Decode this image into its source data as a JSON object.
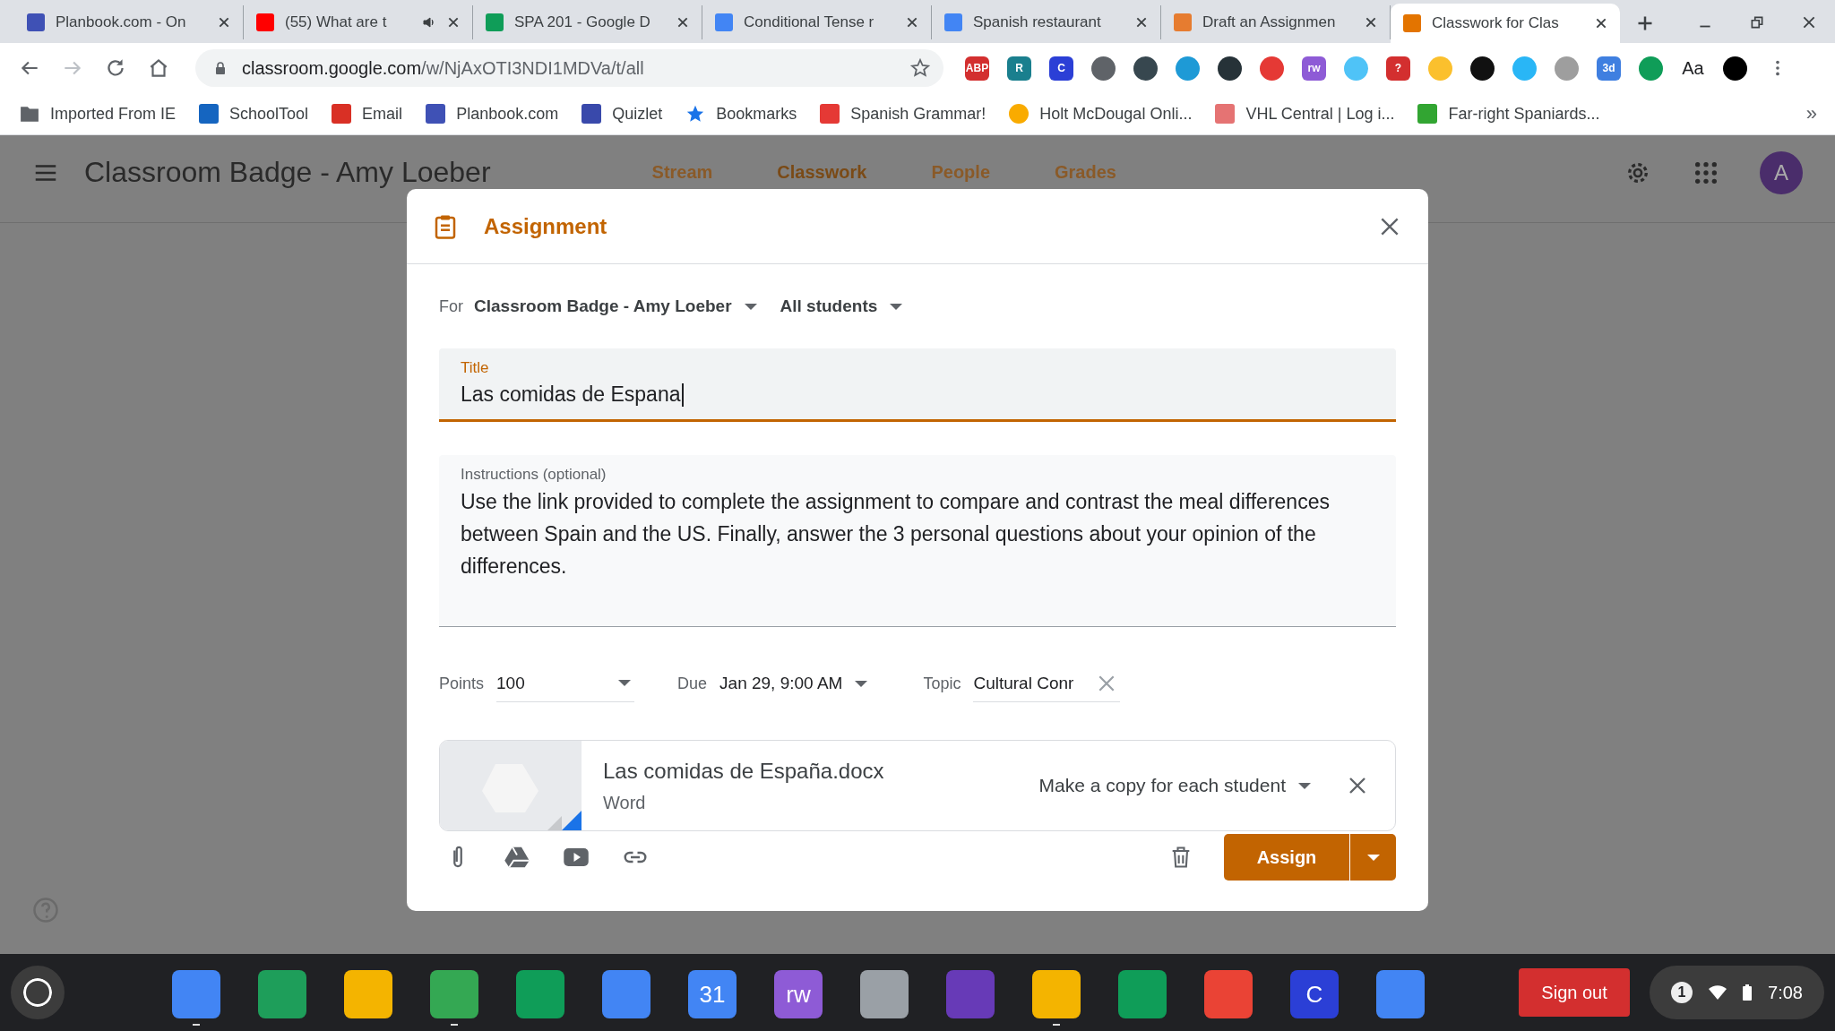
{
  "browser": {
    "tabs": [
      {
        "title": "Planbook.com - On",
        "color": "#3f51b5",
        "audio": false,
        "selected": false
      },
      {
        "title": "(55) What are t",
        "color": "#ff0000",
        "audio": true,
        "selected": false
      },
      {
        "title": "SPA 201 - Google D",
        "color": "#0f9d58",
        "audio": false,
        "selected": false
      },
      {
        "title": "Conditional Tense r",
        "color": "#4285f4",
        "audio": false,
        "selected": false
      },
      {
        "title": "Spanish restaurant",
        "color": "#4285f4",
        "audio": false,
        "selected": false
      },
      {
        "title": "Draft an Assignmen",
        "color": "#e67c30",
        "audio": false,
        "selected": false
      },
      {
        "title": "Classwork for Clas",
        "color": "#e37400",
        "audio": false,
        "selected": true
      }
    ],
    "address": {
      "host": "classroom.google.com",
      "path": "/w/NjAxOTI3NDI1MDVa/t/all"
    },
    "extensions": [
      {
        "kind": "badge",
        "label": "ABP",
        "color": "#d32f2f"
      },
      {
        "kind": "badge",
        "label": "R",
        "color": "#1a7f8e"
      },
      {
        "kind": "badge",
        "label": "C",
        "color": "#2b3fd6"
      },
      {
        "kind": "round",
        "color": "#5f6368"
      },
      {
        "kind": "round",
        "color": "#37474f"
      },
      {
        "kind": "round",
        "color": "#1e9ad6"
      },
      {
        "kind": "round",
        "color": "#263238"
      },
      {
        "kind": "round",
        "color": "#e53935"
      },
      {
        "kind": "badge",
        "label": "rw",
        "color": "#8e5bd6"
      },
      {
        "kind": "round",
        "color": "#4fc3f7"
      },
      {
        "kind": "badge",
        "label": "?",
        "color": "#d32f2f"
      },
      {
        "kind": "round",
        "color": "#fbc02d"
      },
      {
        "kind": "round",
        "color": "#111111"
      },
      {
        "kind": "round",
        "color": "#29b6f6"
      },
      {
        "kind": "round",
        "color": "#9e9e9e"
      },
      {
        "kind": "badge",
        "label": "3d",
        "color": "#3f7fe0"
      },
      {
        "kind": "round",
        "color": "#0f9d58"
      },
      {
        "kind": "text",
        "label": "Aa",
        "color": "#202124"
      },
      {
        "kind": "round",
        "color": "#000000"
      }
    ],
    "bookmarks": [
      {
        "kind": "folder",
        "label": "Imported From IE",
        "color": "#5f6368"
      },
      {
        "kind": "site",
        "label": "SchoolTool",
        "color": "#1565c0"
      },
      {
        "kind": "site",
        "label": "Email",
        "color": "#d93025"
      },
      {
        "kind": "site",
        "label": "Planbook.com",
        "color": "#3f51b5"
      },
      {
        "kind": "site",
        "label": "Quizlet",
        "color": "#3949ab"
      },
      {
        "kind": "star",
        "label": "Bookmarks",
        "color": "#1a73e8"
      },
      {
        "kind": "site",
        "label": "Spanish Grammar!",
        "color": "#e53935"
      },
      {
        "kind": "dot",
        "label": "Holt McDougal Onli...",
        "color": "#f9ab00"
      },
      {
        "kind": "site",
        "label": "VHL Central | Log i...",
        "color": "#e57373"
      },
      {
        "kind": "site",
        "label": "Far-right Spaniards...",
        "color": "#32a532"
      }
    ],
    "more": "»"
  },
  "header": {
    "title": "Classroom Badge - Amy Loeber",
    "avatar": "A",
    "nav": [
      {
        "label": "Stream",
        "selected": false
      },
      {
        "label": "Classwork",
        "selected": true
      },
      {
        "label": "People",
        "selected": false
      },
      {
        "label": "Grades",
        "selected": false
      }
    ]
  },
  "dialog": {
    "title": "Assignment",
    "for_label": "For",
    "class": "Classroom Badge - Amy Loeber",
    "students": "All students",
    "title_field": {
      "label": "Title",
      "value": "Las comidas de Espana"
    },
    "instructions": {
      "label": "Instructions (optional)",
      "value": "Use the link provided to complete the assignment to compare and contrast the meal differences between Spain and the US. Finally, answer the 3 personal questions about your opinion of the differences."
    },
    "points": {
      "label": "Points",
      "value": "100"
    },
    "due": {
      "label": "Due",
      "value": "Jan 29, 9:00 AM"
    },
    "topic": {
      "label": "Topic",
      "value": "Cultural Conr"
    },
    "attachment": {
      "name": "Las comidas de España.docx",
      "type": "Word",
      "mode": "Make a copy for each student"
    },
    "assign": "Assign"
  },
  "shelf": {
    "apps": [
      {
        "color": "#4285f4",
        "running": true
      },
      {
        "color": "#1e9e5a",
        "running": false
      },
      {
        "color": "#f4b400",
        "running": false
      },
      {
        "color": "#34a853",
        "running": true
      },
      {
        "color": "#0f9d58",
        "running": false
      },
      {
        "color": "#4285f4",
        "running": false
      },
      {
        "color": "#4285f4",
        "label": "31",
        "running": false
      },
      {
        "color": "#8e5bd6",
        "label": "rw",
        "running": false
      },
      {
        "color": "#9aa0a6",
        "running": false
      },
      {
        "color": "#673ab7",
        "running": false
      },
      {
        "color": "#f4b400",
        "running": true
      },
      {
        "color": "#0f9d58",
        "running": false
      },
      {
        "color": "#ea4335",
        "running": false
      },
      {
        "color": "#2b3fd6",
        "label": "C",
        "running": false
      },
      {
        "color": "#4285f4",
        "running": false
      }
    ],
    "sign_out": "Sign out",
    "notifications": "1",
    "time": "7:08"
  }
}
